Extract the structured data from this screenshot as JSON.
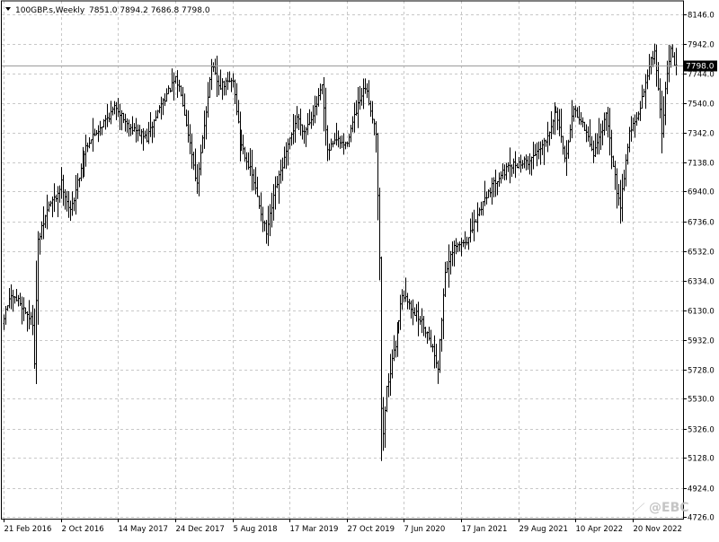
{
  "header": {
    "symbol": "100GBP.s,Weekly",
    "ohlc": "7851.0 7894.2 7686.8 7798.0"
  },
  "watermark": {
    "text": "@EBC"
  },
  "colors": {
    "background": "#ffffff",
    "bars": "#000000",
    "grid": "#c8c8c8",
    "current_price_label_bg": "#000000",
    "current_price_label_text": "#ffffff",
    "watermark": "#bfbfbf"
  },
  "chart_data": {
    "type": "ohlc",
    "title": "100GBP.s,Weekly",
    "current_price": 7798.0,
    "ylim": [
      4726.0,
      8196.0
    ],
    "y_ticks": [
      8146.0,
      7942.0,
      7744.0,
      7540.0,
      7342.0,
      7138.0,
      6940.0,
      6736.0,
      6532.0,
      6334.0,
      6130.0,
      5932.0,
      5728.0,
      5530.0,
      5326.0,
      5128.0,
      4924.0,
      4726.0
    ],
    "y_tick_labels": [
      "8146.0",
      "7942.0",
      "7744.0",
      "7540.0",
      "7342.0",
      "7138.0",
      "6940.0",
      "6736.0",
      "6532.0",
      "6334.0",
      "6130.0",
      "5932.0",
      "5728.0",
      "5530.0",
      "5326.0",
      "5128.0",
      "4924.0",
      "4726.0"
    ],
    "x_ticks": [
      {
        "date": "2016-02-21",
        "label": "21 Feb 2016"
      },
      {
        "date": "2016-10-02",
        "label": "2 Oct 2016"
      },
      {
        "date": "2017-05-14",
        "label": "14 May 2017"
      },
      {
        "date": "2017-12-24",
        "label": "24 Dec 2017"
      },
      {
        "date": "2018-08-05",
        "label": "5 Aug 2018"
      },
      {
        "date": "2019-03-17",
        "label": "17 Mar 2019"
      },
      {
        "date": "2019-10-27",
        "label": "27 Oct 2019"
      },
      {
        "date": "2020-06-07",
        "label": "7 Jun 2020"
      },
      {
        "date": "2021-01-17",
        "label": "17 Jan 2021"
      },
      {
        "date": "2021-08-29",
        "label": "29 Aug 2021"
      },
      {
        "date": "2022-04-10",
        "label": "10 Apr 2022"
      },
      {
        "date": "2022-11-20",
        "label": "20 Nov 2022"
      }
    ],
    "grid": true,
    "path_points": [
      {
        "date": "2016-02-07",
        "value": 5950
      },
      {
        "date": "2016-03-20",
        "value": 6210
      },
      {
        "date": "2016-04-24",
        "value": 6200
      },
      {
        "date": "2016-06-19",
        "value": 6050
      },
      {
        "date": "2016-06-26",
        "value": 5790
      },
      {
        "date": "2016-07-10",
        "value": 6600
      },
      {
        "date": "2016-08-21",
        "value": 6850
      },
      {
        "date": "2016-09-18",
        "value": 6900
      },
      {
        "date": "2016-10-09",
        "value": 7000
      },
      {
        "date": "2016-11-13",
        "value": 6800
      },
      {
        "date": "2017-01-15",
        "value": 7250
      },
      {
        "date": "2017-03-12",
        "value": 7380
      },
      {
        "date": "2017-05-14",
        "value": 7520
      },
      {
        "date": "2017-06-25",
        "value": 7400
      },
      {
        "date": "2017-09-10",
        "value": 7300
      },
      {
        "date": "2017-11-05",
        "value": 7540
      },
      {
        "date": "2017-12-31",
        "value": 7700
      },
      {
        "date": "2018-01-21",
        "value": 7620
      },
      {
        "date": "2018-03-04",
        "value": 7200
      },
      {
        "date": "2018-03-25",
        "value": 6980
      },
      {
        "date": "2018-04-29",
        "value": 7500
      },
      {
        "date": "2018-05-20",
        "value": 7800
      },
      {
        "date": "2018-06-17",
        "value": 7650
      },
      {
        "date": "2018-08-12",
        "value": 7700
      },
      {
        "date": "2018-09-09",
        "value": 7300
      },
      {
        "date": "2018-10-28",
        "value": 7050
      },
      {
        "date": "2018-12-23",
        "value": 6650
      },
      {
        "date": "2019-01-27",
        "value": 6950
      },
      {
        "date": "2019-03-10",
        "value": 7200
      },
      {
        "date": "2019-04-21",
        "value": 7450
      },
      {
        "date": "2019-05-19",
        "value": 7350
      },
      {
        "date": "2019-06-30",
        "value": 7500
      },
      {
        "date": "2019-07-28",
        "value": 7650
      },
      {
        "date": "2019-08-18",
        "value": 7200
      },
      {
        "date": "2019-09-15",
        "value": 7300
      },
      {
        "date": "2019-10-27",
        "value": 7250
      },
      {
        "date": "2019-12-15",
        "value": 7520
      },
      {
        "date": "2020-01-12",
        "value": 7650
      },
      {
        "date": "2020-02-23",
        "value": 7350
      },
      {
        "date": "2020-03-08",
        "value": 6500
      },
      {
        "date": "2020-03-15",
        "value": 5450
      },
      {
        "date": "2020-03-22",
        "value": 5300
      },
      {
        "date": "2020-04-05",
        "value": 5600
      },
      {
        "date": "2020-05-10",
        "value": 5900
      },
      {
        "date": "2020-06-07",
        "value": 6250
      },
      {
        "date": "2020-07-12",
        "value": 6150
      },
      {
        "date": "2020-08-23",
        "value": 6050
      },
      {
        "date": "2020-09-20",
        "value": 5950
      },
      {
        "date": "2020-10-25",
        "value": 5750
      },
      {
        "date": "2020-11-22",
        "value": 6400
      },
      {
        "date": "2020-12-27",
        "value": 6550
      },
      {
        "date": "2021-02-21",
        "value": 6620
      },
      {
        "date": "2021-04-25",
        "value": 6900
      },
      {
        "date": "2021-06-20",
        "value": 7050
      },
      {
        "date": "2021-08-15",
        "value": 7120
      },
      {
        "date": "2021-10-17",
        "value": 7150
      },
      {
        "date": "2021-12-19",
        "value": 7300
      },
      {
        "date": "2022-01-30",
        "value": 7500
      },
      {
        "date": "2022-03-06",
        "value": 7150
      },
      {
        "date": "2022-04-10",
        "value": 7500
      },
      {
        "date": "2022-05-15",
        "value": 7400
      },
      {
        "date": "2022-06-26",
        "value": 7200
      },
      {
        "date": "2022-08-14",
        "value": 7450
      },
      {
        "date": "2022-09-25",
        "value": 6950
      },
      {
        "date": "2022-10-09",
        "value": 6850
      },
      {
        "date": "2022-11-13",
        "value": 7350
      },
      {
        "date": "2022-12-18",
        "value": 7450
      },
      {
        "date": "2023-01-22",
        "value": 7750
      },
      {
        "date": "2023-02-19",
        "value": 7900
      },
      {
        "date": "2023-03-12",
        "value": 7500
      },
      {
        "date": "2023-03-19",
        "value": 7350
      },
      {
        "date": "2023-04-09",
        "value": 7750
      },
      {
        "date": "2023-04-23",
        "value": 7900
      },
      {
        "date": "2023-05-07",
        "value": 7800
      }
    ]
  }
}
